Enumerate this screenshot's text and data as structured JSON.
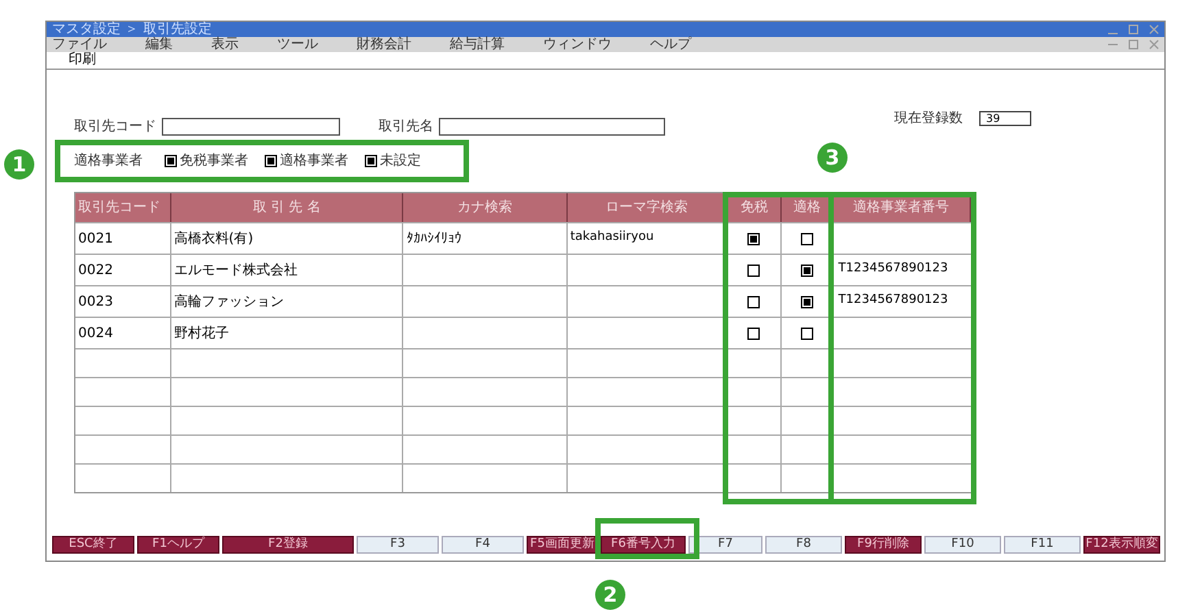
{
  "window": {
    "title": "マスタ設定 ＞ 取引先設定"
  },
  "menu": [
    "ファイル",
    "編集",
    "表示",
    "ツール",
    "財務会計",
    "給与計算",
    "ウィンドウ",
    "ヘルプ"
  ],
  "submenu": [
    "印刷"
  ],
  "fields": [
    {
      "label": "取引先コード"
    },
    {
      "label": "取引先名"
    }
  ],
  "registered": {
    "label": "現在登録数",
    "value": "39"
  },
  "filter": {
    "label": "適格事業者",
    "options": [
      {
        "label": "免税事業者",
        "checked": true
      },
      {
        "label": "適格事業者",
        "checked": true
      },
      {
        "label": "未設定",
        "checked": true
      }
    ]
  },
  "table": {
    "columns": [
      "取引先コード",
      "取 引 先 名",
      "カナ検索",
      "ローマ字検索",
      "免税",
      "適格",
      "適格事業者番号"
    ],
    "rows": [
      {
        "code": "0021",
        "name": "高橋衣料(有)",
        "kana": "ﾀｶﾊｼｲﾘｮｳ",
        "roman": "takahasiiryou",
        "exempt": true,
        "qualified": false,
        "number": ""
      },
      {
        "code": "0022",
        "name": "エルモード株式会社",
        "kana": "",
        "roman": "",
        "exempt": false,
        "qualified": true,
        "number": "T1234567890123"
      },
      {
        "code": "0023",
        "name": "高輪ファッション",
        "kana": "",
        "roman": "",
        "exempt": false,
        "qualified": true,
        "number": "T1234567890123"
      },
      {
        "code": "0024",
        "name": "野村花子",
        "kana": "",
        "roman": "",
        "exempt": false,
        "qualified": false,
        "number": ""
      }
    ]
  },
  "function_keys": [
    {
      "label": "ESC終了",
      "enabled": true
    },
    {
      "label": "F1ヘルプ",
      "enabled": true
    },
    {
      "label": "F2登録",
      "enabled": true
    },
    {
      "label": "F3",
      "enabled": false
    },
    {
      "label": "F4",
      "enabled": false
    },
    {
      "label": "F5画面更新",
      "enabled": true
    },
    {
      "label": "F6番号入力",
      "enabled": true
    },
    {
      "label": "F7",
      "enabled": false
    },
    {
      "label": "F8",
      "enabled": false
    },
    {
      "label": "F9行削除",
      "enabled": true
    },
    {
      "label": "F10",
      "enabled": false
    },
    {
      "label": "F11",
      "enabled": false
    },
    {
      "label": "F12表示順変",
      "enabled": true
    }
  ],
  "callouts": [
    "1",
    "2",
    "3"
  ]
}
